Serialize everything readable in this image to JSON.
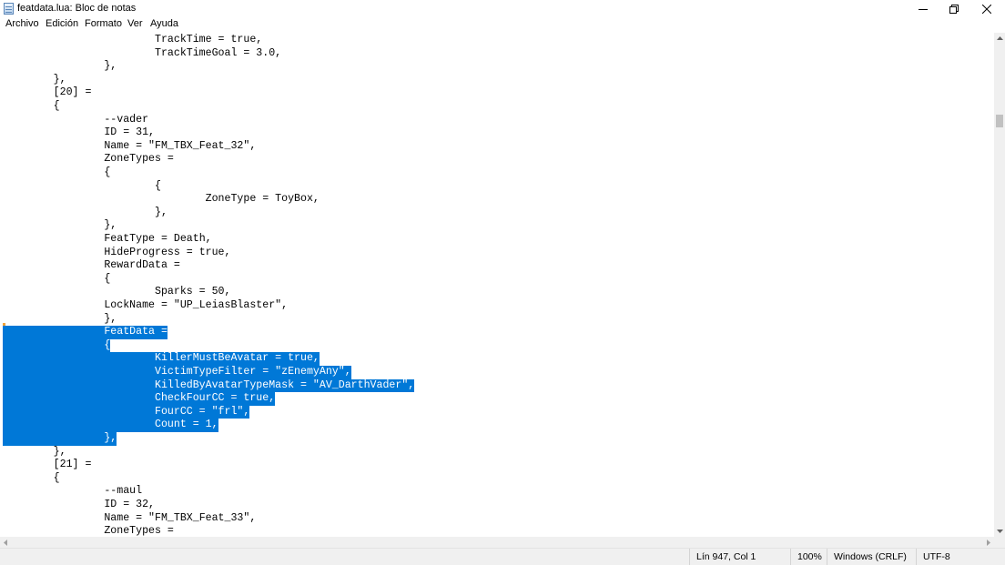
{
  "window": {
    "title": "featdata.lua: Bloc de notas",
    "icon": "notepad-icon",
    "controls": [
      "minimize-icon",
      "restore-icon",
      "close-icon"
    ]
  },
  "menu": [
    "Archivo",
    "Edición",
    "Formato",
    "Ver",
    "Ayuda"
  ],
  "editor": {
    "lines": [
      "\t\t\tTrackTime = true,",
      "\t\t\tTrackTimeGoal = 3.0,",
      "\t\t},",
      "\t},",
      "\t[20] =",
      "\t{",
      "\t\t--vader",
      "\t\tID = 31,",
      "\t\tName = \"FM_TBX_Feat_32\",",
      "\t\tZoneTypes =",
      "\t\t{",
      "\t\t\t{",
      "\t\t\t\tZoneType = ToyBox,",
      "\t\t\t},",
      "\t\t},",
      "\t\tFeatType = Death,",
      "\t\tHideProgress = true,",
      "\t\tRewardData =",
      "\t\t{",
      "\t\t\tSparks = 50,",
      "\t\tLockName = \"UP_LeiasBlaster\",",
      "\t\t},",
      "\t\tFeatData =",
      "\t\t{",
      "\t\t\tKillerMustBeAvatar = true,",
      "\t\t\tVictimTypeFilter = \"zEnemyAny\",",
      "\t\t\tKilledByAvatarTypeMask = \"AV_DarthVader\",",
      "\t\t\tCheckFourCC = true,",
      "\t\t\tFourCC = \"frl\",",
      "\t\t\tCount = 1,",
      "\t\t},",
      "\t},",
      "\t[21] =",
      "\t{",
      "\t\t--maul",
      "\t\tID = 32,",
      "\t\tName = \"FM_TBX_Feat_33\",",
      "\t\tZoneTypes ="
    ],
    "selected_lines": [
      22,
      23,
      24,
      25,
      26,
      27,
      28,
      29,
      30
    ]
  },
  "status": {
    "position": "Lín 947, Col 1",
    "zoom": "100%",
    "line_ending": "Windows (CRLF)",
    "encoding": "UTF-8"
  }
}
